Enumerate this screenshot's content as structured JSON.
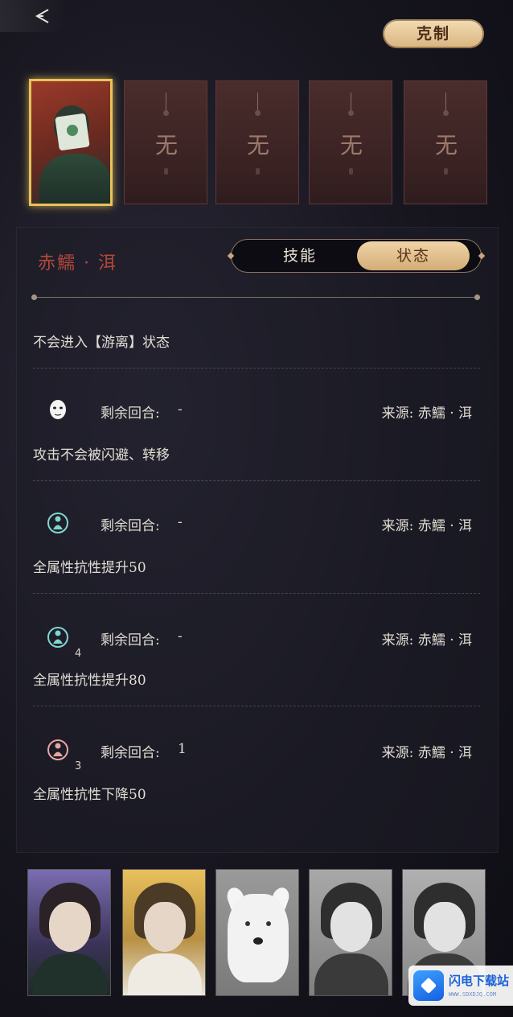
{
  "header": {
    "counter_label": "克制"
  },
  "slots": [
    {
      "label": "无"
    },
    {
      "label": "无"
    },
    {
      "label": "无"
    },
    {
      "label": "无"
    }
  ],
  "detail": {
    "character_name": "赤鱬 · 洱",
    "tabs": [
      {
        "label": "技能",
        "active": false
      },
      {
        "label": "状态",
        "active": true
      }
    ],
    "passive_status": "不会进入【游离】状态",
    "effects": [
      {
        "icon": "mask-face-icon",
        "icon_color": "#ffffff",
        "stack": "",
        "remaining_label": "剩余回合:",
        "remaining": "-",
        "source": "来源: 赤鱬 · 洱",
        "description": "攻击不会被闪避、转移"
      },
      {
        "icon": "resist-up-icon",
        "icon_color": "#7fd6d0",
        "stack": "",
        "remaining_label": "剩余回合:",
        "remaining": "-",
        "source": "来源: 赤鱬 · 洱",
        "description": "全属性抗性提升50"
      },
      {
        "icon": "resist-up-icon",
        "icon_color": "#7fd6d0",
        "stack": "4",
        "remaining_label": "剩余回合:",
        "remaining": "-",
        "source": "来源: 赤鱬 · 洱",
        "description": "全属性抗性提升80"
      },
      {
        "icon": "resist-down-icon",
        "icon_color": "#e8a5a0",
        "stack": "3",
        "remaining_label": "剩余回合:",
        "remaining": "1",
        "source": "来源: 赤鱬 · 洱",
        "description": "全属性抗性下降50"
      }
    ]
  },
  "watermark": {
    "title": "闪电下载站",
    "url": "WWW.SDXDJQ.COM"
  }
}
